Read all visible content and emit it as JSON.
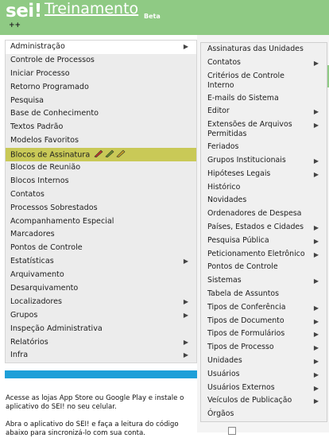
{
  "header": {
    "logo": "sei",
    "logo_excl": "!",
    "app_name": "Treinamento",
    "beta": "Beta",
    "plusplus": "++"
  },
  "menu": {
    "items": [
      {
        "label": "Administração",
        "submenu": true,
        "active": true
      },
      {
        "label": "Controle de Processos"
      },
      {
        "label": "Iniciar Processo"
      },
      {
        "label": "Retorno Programado"
      },
      {
        "label": "Pesquisa"
      },
      {
        "label": "Base de Conhecimento"
      },
      {
        "label": "Textos Padrão"
      },
      {
        "label": "Modelos Favoritos"
      },
      {
        "label": "Blocos de Assinatura",
        "highlight": true
      },
      {
        "label": "Blocos de Reunião"
      },
      {
        "label": "Blocos Internos"
      },
      {
        "label": "Contatos"
      },
      {
        "label": "Processos Sobrestados"
      },
      {
        "label": "Acompanhamento Especial"
      },
      {
        "label": "Marcadores"
      },
      {
        "label": "Pontos de Controle"
      },
      {
        "label": "Estatísticas",
        "submenu": true
      },
      {
        "label": "Arquivamento"
      },
      {
        "label": "Desarquivamento"
      },
      {
        "label": "Localizadores",
        "submenu": true
      },
      {
        "label": "Grupos",
        "submenu": true
      },
      {
        "label": "Inspeção Administrativa"
      },
      {
        "label": "Relatórios",
        "submenu": true
      },
      {
        "label": "Infra",
        "submenu": true
      }
    ]
  },
  "submenu": {
    "items": [
      {
        "label": "Assinaturas das Unidades"
      },
      {
        "label": "Contatos",
        "submenu": true
      },
      {
        "label": "Critérios de Controle Interno"
      },
      {
        "label": "E-mails do Sistema"
      },
      {
        "label": "Editor",
        "submenu": true
      },
      {
        "label": "Extensões de Arquivos Permitidas",
        "submenu": true
      },
      {
        "label": "Feriados"
      },
      {
        "label": "Grupos Institucionais",
        "submenu": true
      },
      {
        "label": "Hipóteses Legais",
        "submenu": true
      },
      {
        "label": "Histórico"
      },
      {
        "label": "Novidades"
      },
      {
        "label": "Ordenadores de Despesa"
      },
      {
        "label": "Países, Estados e Cidades",
        "submenu": true
      },
      {
        "label": "Pesquisa Pública",
        "submenu": true
      },
      {
        "label": "Peticionamento Eletrônico",
        "submenu": true
      },
      {
        "label": "Pontos de Controle"
      },
      {
        "label": "Sistemas",
        "submenu": true
      },
      {
        "label": "Tabela de Assuntos"
      },
      {
        "label": "Tipos de Conferência",
        "submenu": true
      },
      {
        "label": "Tipos de Documento",
        "submenu": true
      },
      {
        "label": "Tipos de Formulários",
        "submenu": true
      },
      {
        "label": "Tipos de Processo",
        "submenu": true
      },
      {
        "label": "Unidades",
        "submenu": true
      },
      {
        "label": "Usuários",
        "submenu": true
      },
      {
        "label": "Usuários Externos",
        "submenu": true
      },
      {
        "label": "Veículos de Publicação",
        "submenu": true
      },
      {
        "label": "Órgãos"
      }
    ]
  },
  "footer": {
    "info1": "Acesse as lojas App Store ou Google Play e instale o aplicativo do SEI! no seu celular.",
    "info2": "Abra o aplicativo do SEI! e faça a leitura do código abaixo para sincronizá-lo com sua conta."
  },
  "colors": {
    "header_green": "#8fca84",
    "highlight": "#c9c957",
    "blue_bar": "#1e9fd8"
  }
}
